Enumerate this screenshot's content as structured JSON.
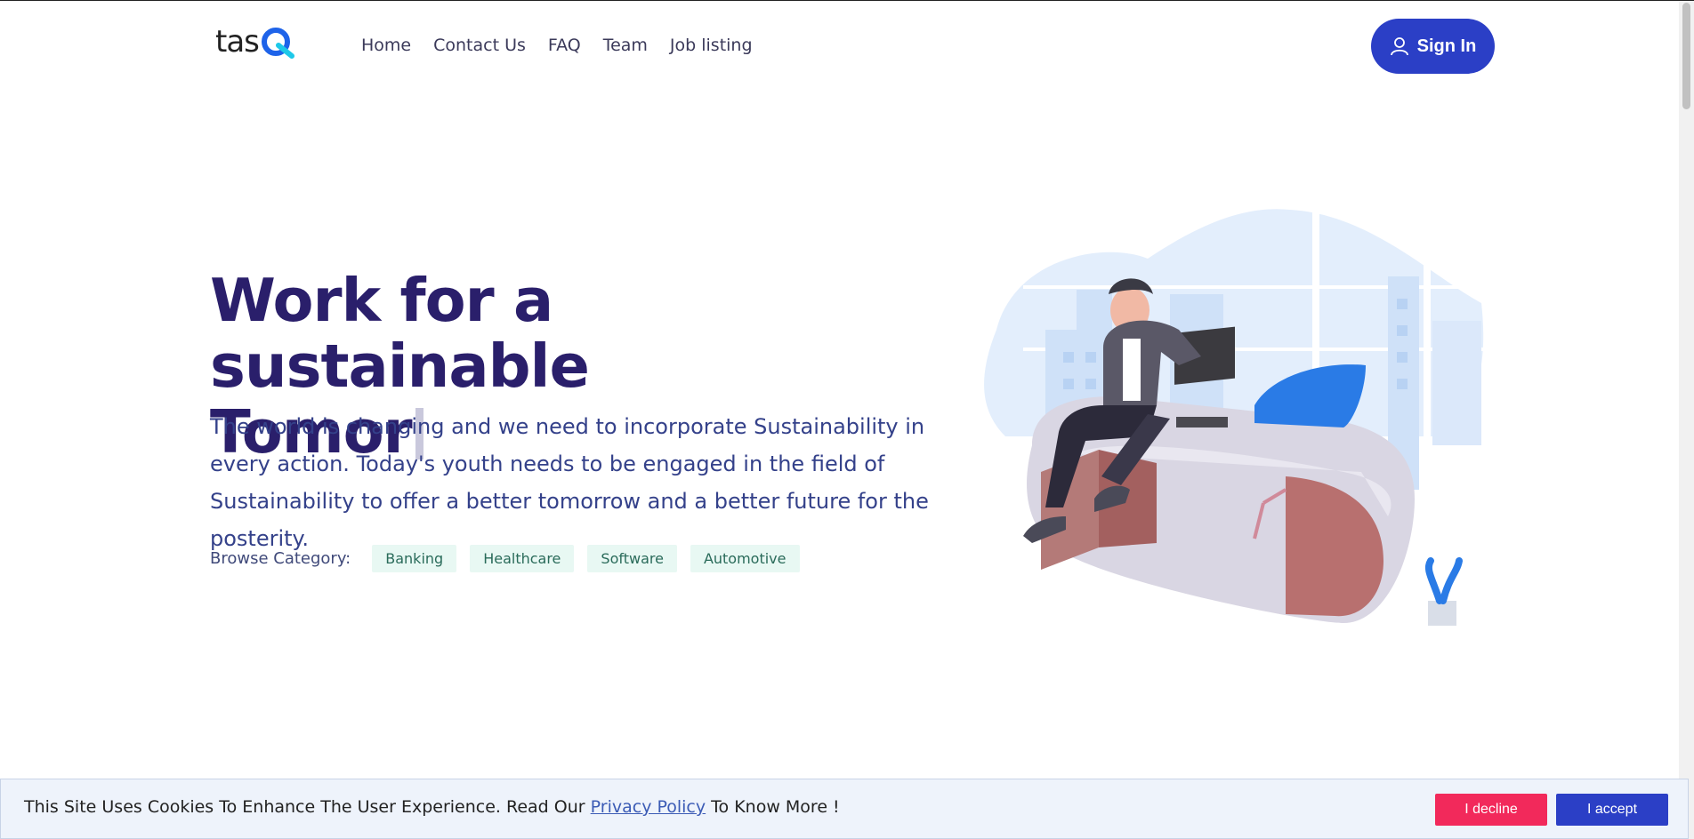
{
  "header": {
    "logo_text": "tas",
    "nav": [
      "Home",
      "Contact Us",
      "FAQ",
      "Team",
      "Job listing"
    ],
    "signin_label": "Sign In"
  },
  "hero": {
    "title_line1": "Work for a sustainable",
    "title_line2": "Tomor",
    "description": "The world is changing and we need to incorporate Sustainability in every action. Today's youth needs to be engaged in the field of Sustainability to offer a better tomorrow and a better future for the posterity.",
    "browse_label": "Browse Category:",
    "categories": [
      "Banking",
      "Healthcare",
      "Software",
      "Automotive"
    ]
  },
  "cookie": {
    "text_before": "This Site Uses Cookies To Enhance The User Experience. Read Our",
    "link": "Privacy Policy",
    "text_after": "To Know More !",
    "decline": "I decline",
    "accept": "I accept"
  },
  "colors": {
    "primary": "#2b3fc6",
    "title": "#2a1f6b",
    "decline": "#f2295b",
    "chip_bg": "#e8f8f3"
  },
  "icons": [
    "user-icon",
    "logo-q-icon"
  ]
}
